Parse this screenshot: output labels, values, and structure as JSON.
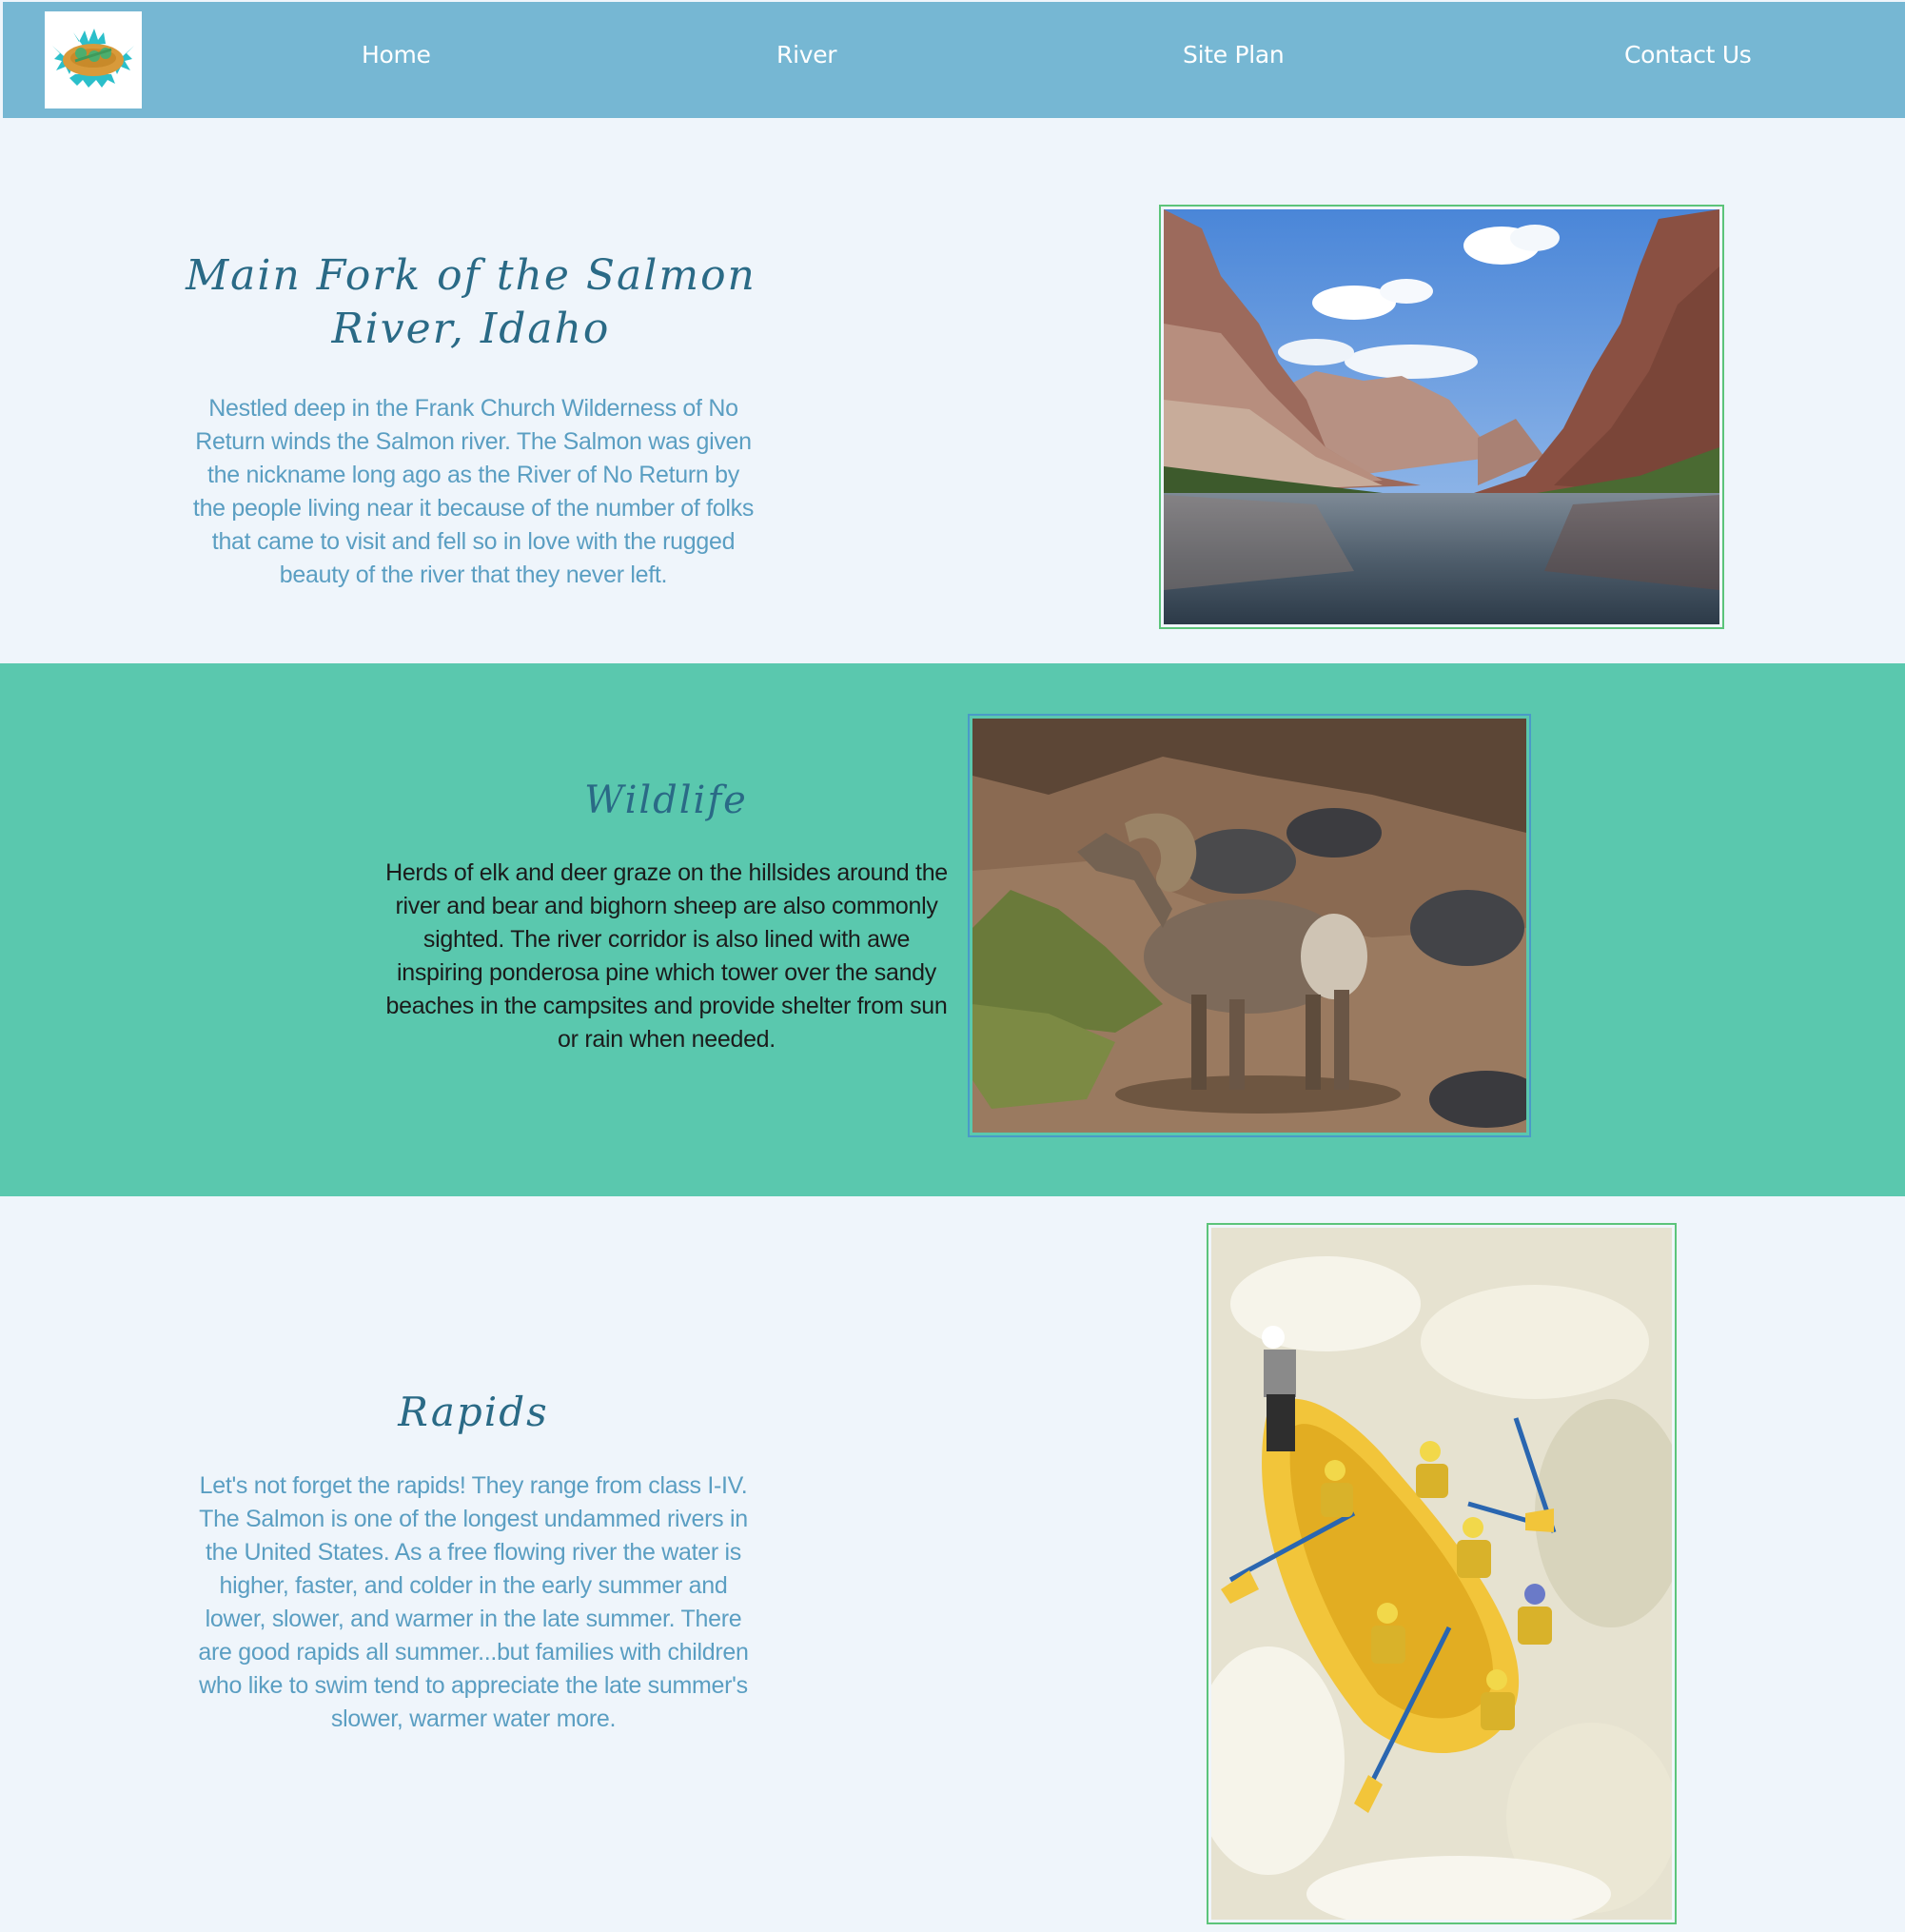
{
  "nav": {
    "logo_icon": "rafting-logo-icon",
    "items": [
      {
        "label": "Home"
      },
      {
        "label": "River"
      },
      {
        "label": "Site Plan"
      },
      {
        "label": "Contact Us"
      }
    ]
  },
  "colors": {
    "header_bg": "#76b7d3",
    "page_bg": "#eff5fb",
    "teal_band": "#5ac8ae",
    "heading": "#2a6a86",
    "body_blue": "#5a9ec2",
    "frame_green": "#5cc47a",
    "frame_blue": "#4a9ac8"
  },
  "sections": {
    "main": {
      "title_line1": "Main Fork of the Salmon",
      "title_line2": "River, Idaho",
      "text": "Nestled deep in the Frank Church Wilderness of No Return winds the Salmon river. The Salmon was given the nickname long ago as the River of No Return by the people living near it because of the number of folks that came to visit and fell so in love with the rugged beauty of the river that they never left.",
      "image": "canyon-river-photo"
    },
    "wildlife": {
      "title": "Wildlife",
      "text": "Herds of elk and deer graze on the hillsides around the river and bear and bighorn sheep are also commonly sighted. The river corridor is also lined with awe inspiring ponderosa pine which tower over the sandy beaches in the campsites and provide shelter from sun or rain when needed.",
      "image": "bighorn-sheep-photo"
    },
    "rapids": {
      "title": "Rapids",
      "text": "Let's not forget the rapids! They range from class I-IV. The Salmon is one of the longest undammed rivers in the United States. As a free flowing river the water is higher, faster, and colder in the early summer and lower, slower, and warmer in the late summer. There are good rapids all summer...but families with children who like to swim tend to appreciate the late summer's slower, warmer water more.",
      "image": "whitewater-raft-photo"
    }
  }
}
